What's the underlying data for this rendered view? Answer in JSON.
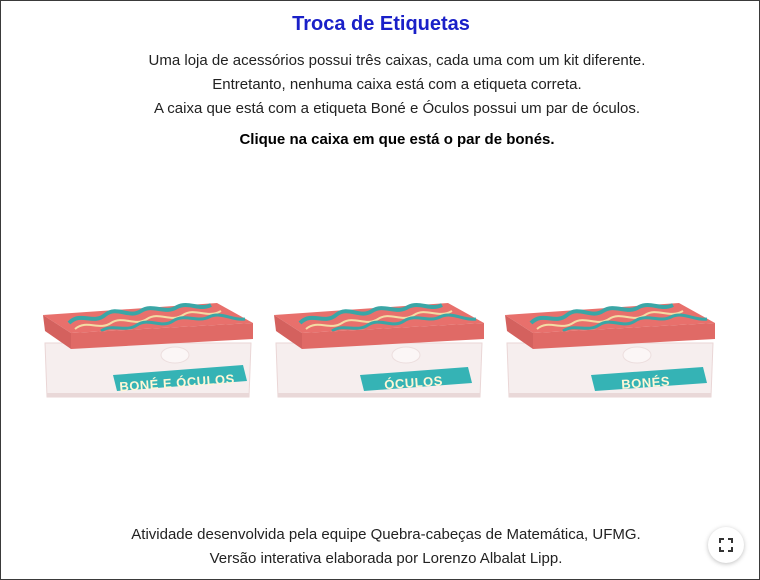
{
  "title": "Troca de Etiquetas",
  "description": [
    "Uma loja de acessórios possui três caixas, cada uma com um kit diferente.",
    "Entretanto, nenhuma caixa está com a etiqueta correta.",
    "A caixa que está com a etiqueta Boné e Óculos possui um par de óculos."
  ],
  "instruction": "Clique na caixa em que está o par de bonés.",
  "boxes": [
    {
      "label": "BONÉ E ÓCULOS"
    },
    {
      "label": "ÓCULOS"
    },
    {
      "label": "BONÉS"
    }
  ],
  "footer": [
    "Atividade desenvolvida pela equipe Quebra-cabeças de Matemática, UFMG.",
    "Versão interativa elaborada por Lorenzo Albalat Lipp."
  ],
  "colors": {
    "title": "#1a20c8",
    "lid": "#e8706c",
    "lid_side": "#d4615e",
    "wave_teal": "#3aa6a6",
    "wave_cream": "#f3dca4",
    "label_band": "#35b3b5"
  },
  "icons": {
    "fullscreen": "fullscreen-icon"
  }
}
